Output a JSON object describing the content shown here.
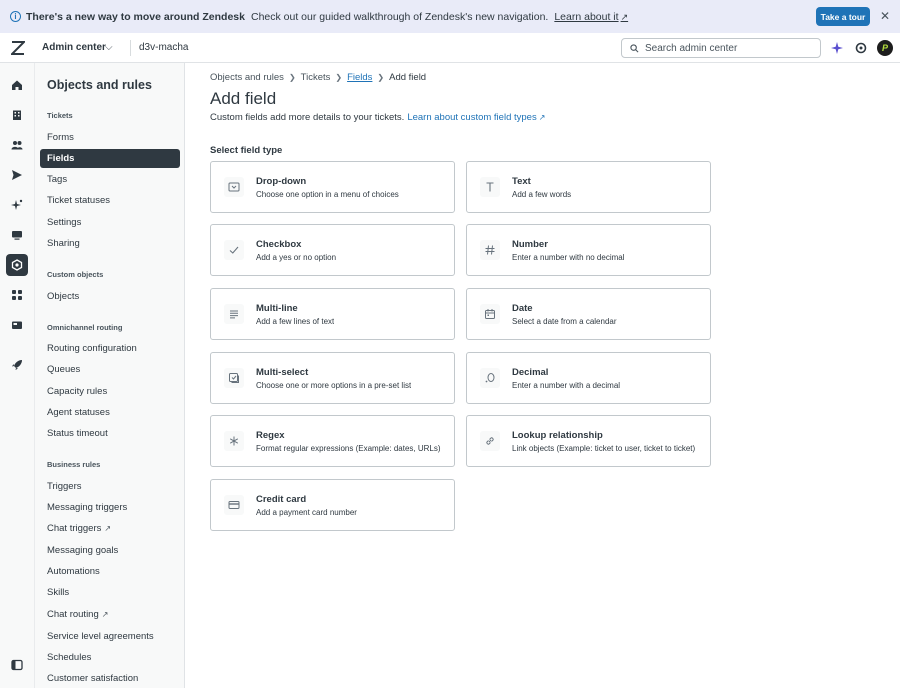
{
  "banner": {
    "headline": "There's a new way to move around Zendesk",
    "message": "Check out our guided walkthrough of Zendesk's new navigation.",
    "link": "Learn about it",
    "tour_button": "Take a tour"
  },
  "header": {
    "product": "Admin center",
    "subdomain": "d3v-macha",
    "search_placeholder": "Search admin center",
    "avatar_initial": "P"
  },
  "rail": {
    "icons": [
      "home-icon",
      "building-icon",
      "people-icon",
      "send-icon",
      "sparkle-icon",
      "monitor-icon",
      "objects-rules-icon",
      "apps-icon",
      "channels-icon",
      "rocket-icon",
      "panel-toggle-icon"
    ]
  },
  "sidebar": {
    "title": "Objects and rules",
    "groups": {
      "tickets": "Tickets",
      "custom_objects": "Custom objects",
      "routing": "Omnichannel routing",
      "business_rules": "Business rules"
    },
    "items": {
      "forms": "Forms",
      "fields": "Fields",
      "tags": "Tags",
      "ticket_statuses": "Ticket statuses",
      "settings": "Settings",
      "sharing": "Sharing",
      "objects": "Objects",
      "routing_configuration": "Routing configuration",
      "queues": "Queues",
      "capacity_rules": "Capacity rules",
      "agent_statuses": "Agent statuses",
      "status_timeout": "Status timeout",
      "triggers": "Triggers",
      "messaging_triggers": "Messaging triggers",
      "chat_triggers": "Chat triggers",
      "messaging_goals": "Messaging goals",
      "automations": "Automations",
      "skills": "Skills",
      "chat_routing": "Chat routing",
      "sla": "Service level agreements",
      "schedules": "Schedules",
      "customer_satisfaction": "Customer satisfaction"
    }
  },
  "main": {
    "breadcrumb": {
      "objects_and_rules": "Objects and rules",
      "tickets": "Tickets",
      "fields": "Fields",
      "current": "Add field"
    },
    "title": "Add field",
    "subtitle": "Custom fields add more details to your tickets.",
    "subtitle_link": "Learn about custom field types",
    "section_label": "Select field type",
    "cards": {
      "dropdown": {
        "title": "Drop-down",
        "desc": "Choose one option in a menu of choices"
      },
      "text": {
        "title": "Text",
        "desc": "Add a few words"
      },
      "checkbox": {
        "title": "Checkbox",
        "desc": "Add a yes or no option"
      },
      "number": {
        "title": "Number",
        "desc": "Enter a number with no decimal"
      },
      "multiline": {
        "title": "Multi-line",
        "desc": "Add a few lines of text"
      },
      "date": {
        "title": "Date",
        "desc": "Select a date from a calendar"
      },
      "multiselect": {
        "title": "Multi-select",
        "desc": "Choose one or more options in a pre-set list"
      },
      "decimal": {
        "title": "Decimal",
        "desc": "Enter a number with a decimal"
      },
      "regex": {
        "title": "Regex",
        "desc": "Format regular expressions (Example: dates, URLs)"
      },
      "lookup": {
        "title": "Lookup relationship",
        "desc": "Link objects (Example: ticket to user, ticket to ticket)"
      },
      "credit_card": {
        "title": "Credit card",
        "desc": "Add a payment card number"
      }
    }
  },
  "colors": {
    "accent": "#1f73b7",
    "banner_bg": "#e9ebf8",
    "active_nav": "#2f3941"
  }
}
